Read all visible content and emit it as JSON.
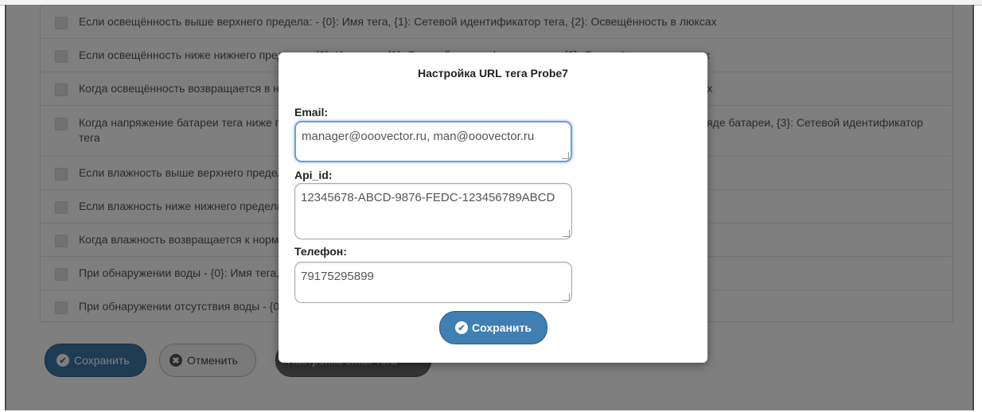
{
  "rules": [
    "Если освещённость выше верхнего предела: - {0}: Имя тега, {1}: Сетевой идентификатор тега, {2}: Освещённость в люксах",
    "Если освещённость ниже нижнего предела: - {0}: Имя тега, {1}: Сетевой идентификатор тега, {2}: Освещённость в люксах",
    "Когда освещённость возвращается в норму: - {0}: Имя тега, {1}: Сетевой идентификатор тега, {2}: Освещённость в люксах",
    "Когда напряжение батареи тега ниже порога: - {0}: Имя тега, {1}: Напряжение батареи, {2}: Порог предупреждения о разряде батареи, {3}: Сетевой идентификатор тега",
    "Если влажность выше верхнего предела: - {0}: Имя тега, {1}: Влажность, {2}: Сетевой идентификатор тега",
    "Если влажность ниже нижнего предела: - {0}: Имя тега, {1}: Влажность, {2}: Сетевой идентификатор тега",
    "Когда влажность возвращается к норме: - {0}: Имя тега, {1}: Влажность, {2}: Сетевой идентификатор тега",
    "При обнаружении воды - {0}: Имя тега, {1}: Сетевой идентификатор тега",
    "При обнаружении отсутствия воды - {0}: Имя тега, {1}: Сетевой идентификатор тега, {2}: Время обнаружения"
  ],
  "footer": {
    "save_label": "Сохранить",
    "cancel_label": "Отменить",
    "email_settings_label": "Настройка email-тега"
  },
  "modal": {
    "title": "Настройка URL тега Probe7",
    "email_label": "Email:",
    "email_value": "manager@ooovector.ru, man@ooovector.ru",
    "api_label": "Api_id:",
    "api_value": "12345678-ABCD-9876-FEDC-123456789ABCD",
    "phone_label": "Телефон:",
    "phone_value": "79175295899",
    "save_label": "Сохранить"
  },
  "icons": {
    "check": "check-circle-icon",
    "cancel": "x-circle-icon"
  },
  "colors": {
    "primary_button": "#3f7fb3",
    "focus_border": "#6e9ed6",
    "overlay": "rgba(0,0,0,0.5)"
  }
}
